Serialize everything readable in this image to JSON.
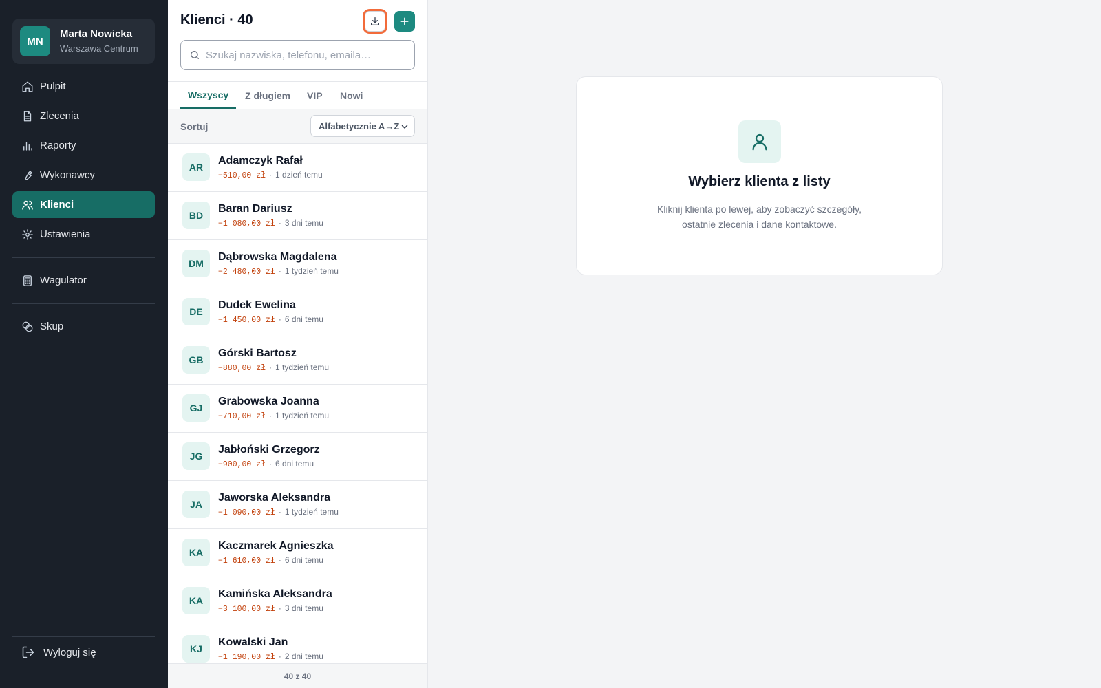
{
  "user": {
    "initials": "MN",
    "name": "Marta Nowicka",
    "branch": "Warszawa Centrum"
  },
  "nav": {
    "items": [
      {
        "label": "Pulpit",
        "icon": "home-icon"
      },
      {
        "label": "Zlecenia",
        "icon": "file-icon"
      },
      {
        "label": "Raporty",
        "icon": "bar-chart-icon"
      },
      {
        "label": "Wykonawcy",
        "icon": "wrench-icon"
      },
      {
        "label": "Klienci",
        "icon": "users-icon",
        "active": true
      },
      {
        "label": "Ustawienia",
        "icon": "gear-icon"
      }
    ],
    "calculator": "Wagulator",
    "purchase": "Skup",
    "logout": "Wyloguj się"
  },
  "list": {
    "title": "Klienci · 40",
    "search_placeholder": "Szukaj nazwiska, telefonu, emaila…",
    "tabs": [
      "Wszyscy",
      "Z długiem",
      "VIP",
      "Nowi"
    ],
    "active_tab": "Wszyscy",
    "sort_label": "Sortuj",
    "sort_value": "Alfabetycznie A→Z",
    "footer": "40 z 40",
    "clients": [
      {
        "initials": "AR",
        "name": "Adamczyk Rafał",
        "debt": "−510,00 zł",
        "last": "1 dzień temu"
      },
      {
        "initials": "BD",
        "name": "Baran Dariusz",
        "debt": "−1 080,00 zł",
        "last": "3 dni temu"
      },
      {
        "initials": "DM",
        "name": "Dąbrowska Magdalena",
        "debt": "−2 480,00 zł",
        "last": "1 tydzień temu"
      },
      {
        "initials": "DE",
        "name": "Dudek Ewelina",
        "debt": "−1 450,00 zł",
        "last": "6 dni temu"
      },
      {
        "initials": "GB",
        "name": "Górski Bartosz",
        "debt": "−880,00 zł",
        "last": "1 tydzień temu"
      },
      {
        "initials": "GJ",
        "name": "Grabowska Joanna",
        "debt": "−710,00 zł",
        "last": "1 tydzień temu"
      },
      {
        "initials": "JG",
        "name": "Jabłoński Grzegorz",
        "debt": "−900,00 zł",
        "last": "6 dni temu"
      },
      {
        "initials": "JA",
        "name": "Jaworska Aleksandra",
        "debt": "−1 090,00 zł",
        "last": "1 tydzień temu"
      },
      {
        "initials": "KA",
        "name": "Kaczmarek Agnieszka",
        "debt": "−1 610,00 zł",
        "last": "6 dni temu"
      },
      {
        "initials": "KA",
        "name": "Kamińska Aleksandra",
        "debt": "−3 100,00 zł",
        "last": "3 dni temu"
      },
      {
        "initials": "KJ",
        "name": "Kowalski Jan",
        "debt": "−1 190,00 zł",
        "last": "2 dni temu"
      }
    ]
  },
  "empty_state": {
    "title": "Wybierz klienta z listy",
    "description": "Kliknij klienta po lewej, aby zobaczyć szczegóły, ostatnie zlecenia i dane kontaktowe."
  },
  "colors": {
    "accent": "#176d65",
    "sidebar": "#1a2029",
    "debt": "#c2410c",
    "highlight": "#f26b3a"
  }
}
